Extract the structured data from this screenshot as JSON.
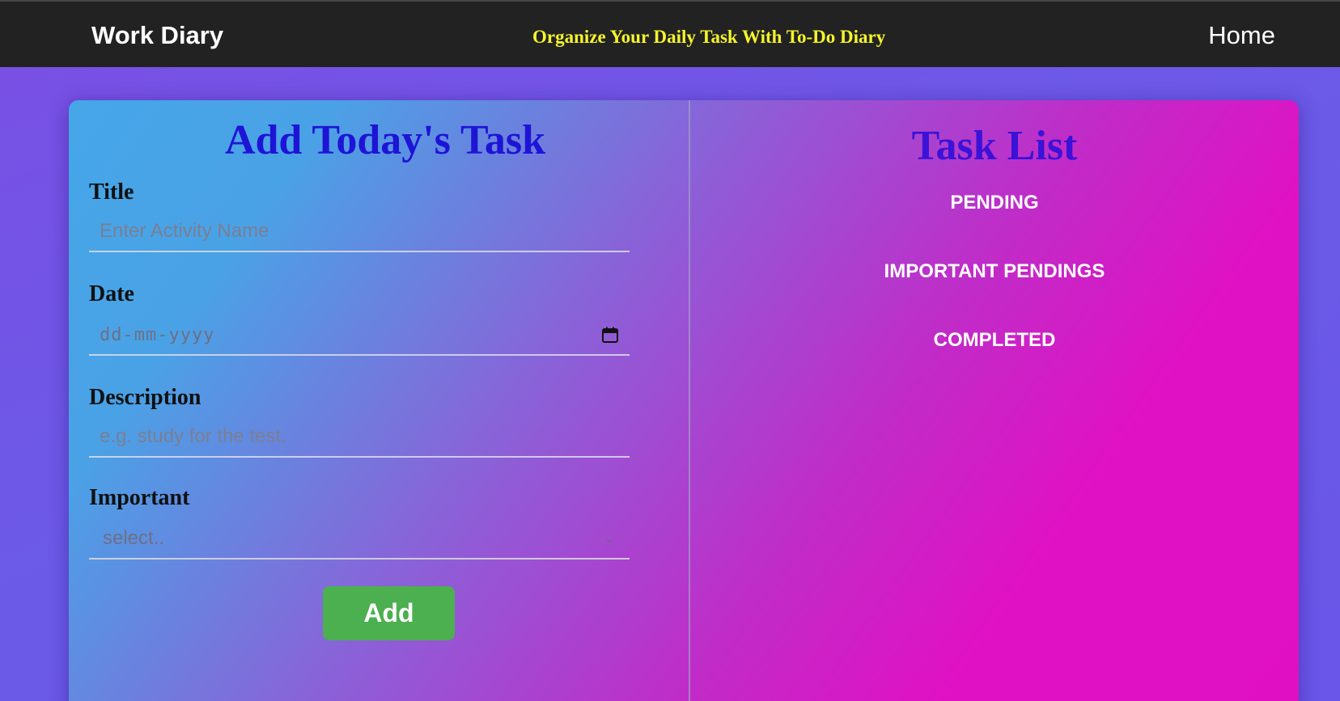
{
  "navbar": {
    "brand": "Work Diary",
    "tagline": "Organize Your Daily Task With To-Do Diary",
    "home_link": "Home"
  },
  "form": {
    "title": "Add Today's Task",
    "title_label": "Title",
    "title_placeholder": "Enter Activity Name",
    "date_label": "Date",
    "date_placeholder": "dd-mm-yyyy",
    "description_label": "Description",
    "description_placeholder": "e.g. study for the test.",
    "important_label": "Important",
    "important_selected": "select..",
    "add_button": "Add"
  },
  "task_list": {
    "title": "Task List",
    "sections": [
      "PENDING",
      "IMPORTANT PENDINGS",
      "COMPLETED"
    ]
  },
  "colors": {
    "navbar_bg": "#222222",
    "tagline": "#f4f42b",
    "form_title": "#1e14d6",
    "list_title": "#3a12d8",
    "add_button": "#4caf50"
  },
  "icons": {
    "date_picker": "calendar-icon",
    "select_arrow": "chevron-down-icon"
  }
}
